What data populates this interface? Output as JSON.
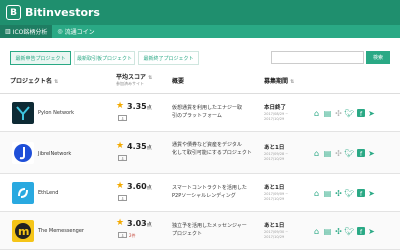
{
  "header": {
    "logo": "B",
    "brand": "Bitinvestors"
  },
  "nav": [
    {
      "label": "ICO銘柄分析",
      "icon": "chart-icon"
    },
    {
      "label": "流通コイン",
      "icon": "coin-icon"
    }
  ],
  "subtabs": [
    "最新申告プロジェクト",
    "最新取引板プロジェクト",
    "最新終了プロジェクト"
  ],
  "search": {
    "placeholder": "",
    "button_label": "検索"
  },
  "table": {
    "headers": {
      "name": "プロジェクト名",
      "score": "平均スコア",
      "score_sub": "参加済みサイト",
      "overview": "概要",
      "period": "募集期間"
    },
    "rows": [
      {
        "name": "Pylon Network",
        "score": "3.35",
        "score_unit": "点",
        "badge": "",
        "desc_1": "仮想通貨を利用したエナジー取",
        "desc_2": "引のプラットフォーム",
        "period": "本日終了",
        "dates": "2017/08/29 ~ 2017/10/29",
        "logo_color": "#0d2a34"
      },
      {
        "name": "JibrelNetwork",
        "score": "4.35",
        "score_unit": "点",
        "badge": "",
        "desc_1": "通貨や債券など資産をデジタル",
        "desc_2": "化して取引可能にするプロジェクト",
        "period": "あと1日",
        "dates": "2017/09/28 ~ 2017/10/29",
        "logo_color": "#1f4fd8"
      },
      {
        "name": "EthLend",
        "score": "3.60",
        "score_unit": "点",
        "badge": "",
        "desc_1": "スマートコントラクトを活用した",
        "desc_2": "P2Pソーシャルレンディング",
        "period": "あと1日",
        "dates": "2017/09/09 ~ 2017/10/29",
        "logo_color": "#29a9e0"
      },
      {
        "name": "The Memessenger",
        "score": "3.03",
        "score_unit": "点",
        "badge": "2件",
        "desc_1": "独立予を活用したメッセンジャー",
        "desc_2": "プロジェクト",
        "period": "あと1日",
        "dates": "2017/09/30 ~ 2017/10/29",
        "logo_color": "#f5c518"
      }
    ]
  }
}
